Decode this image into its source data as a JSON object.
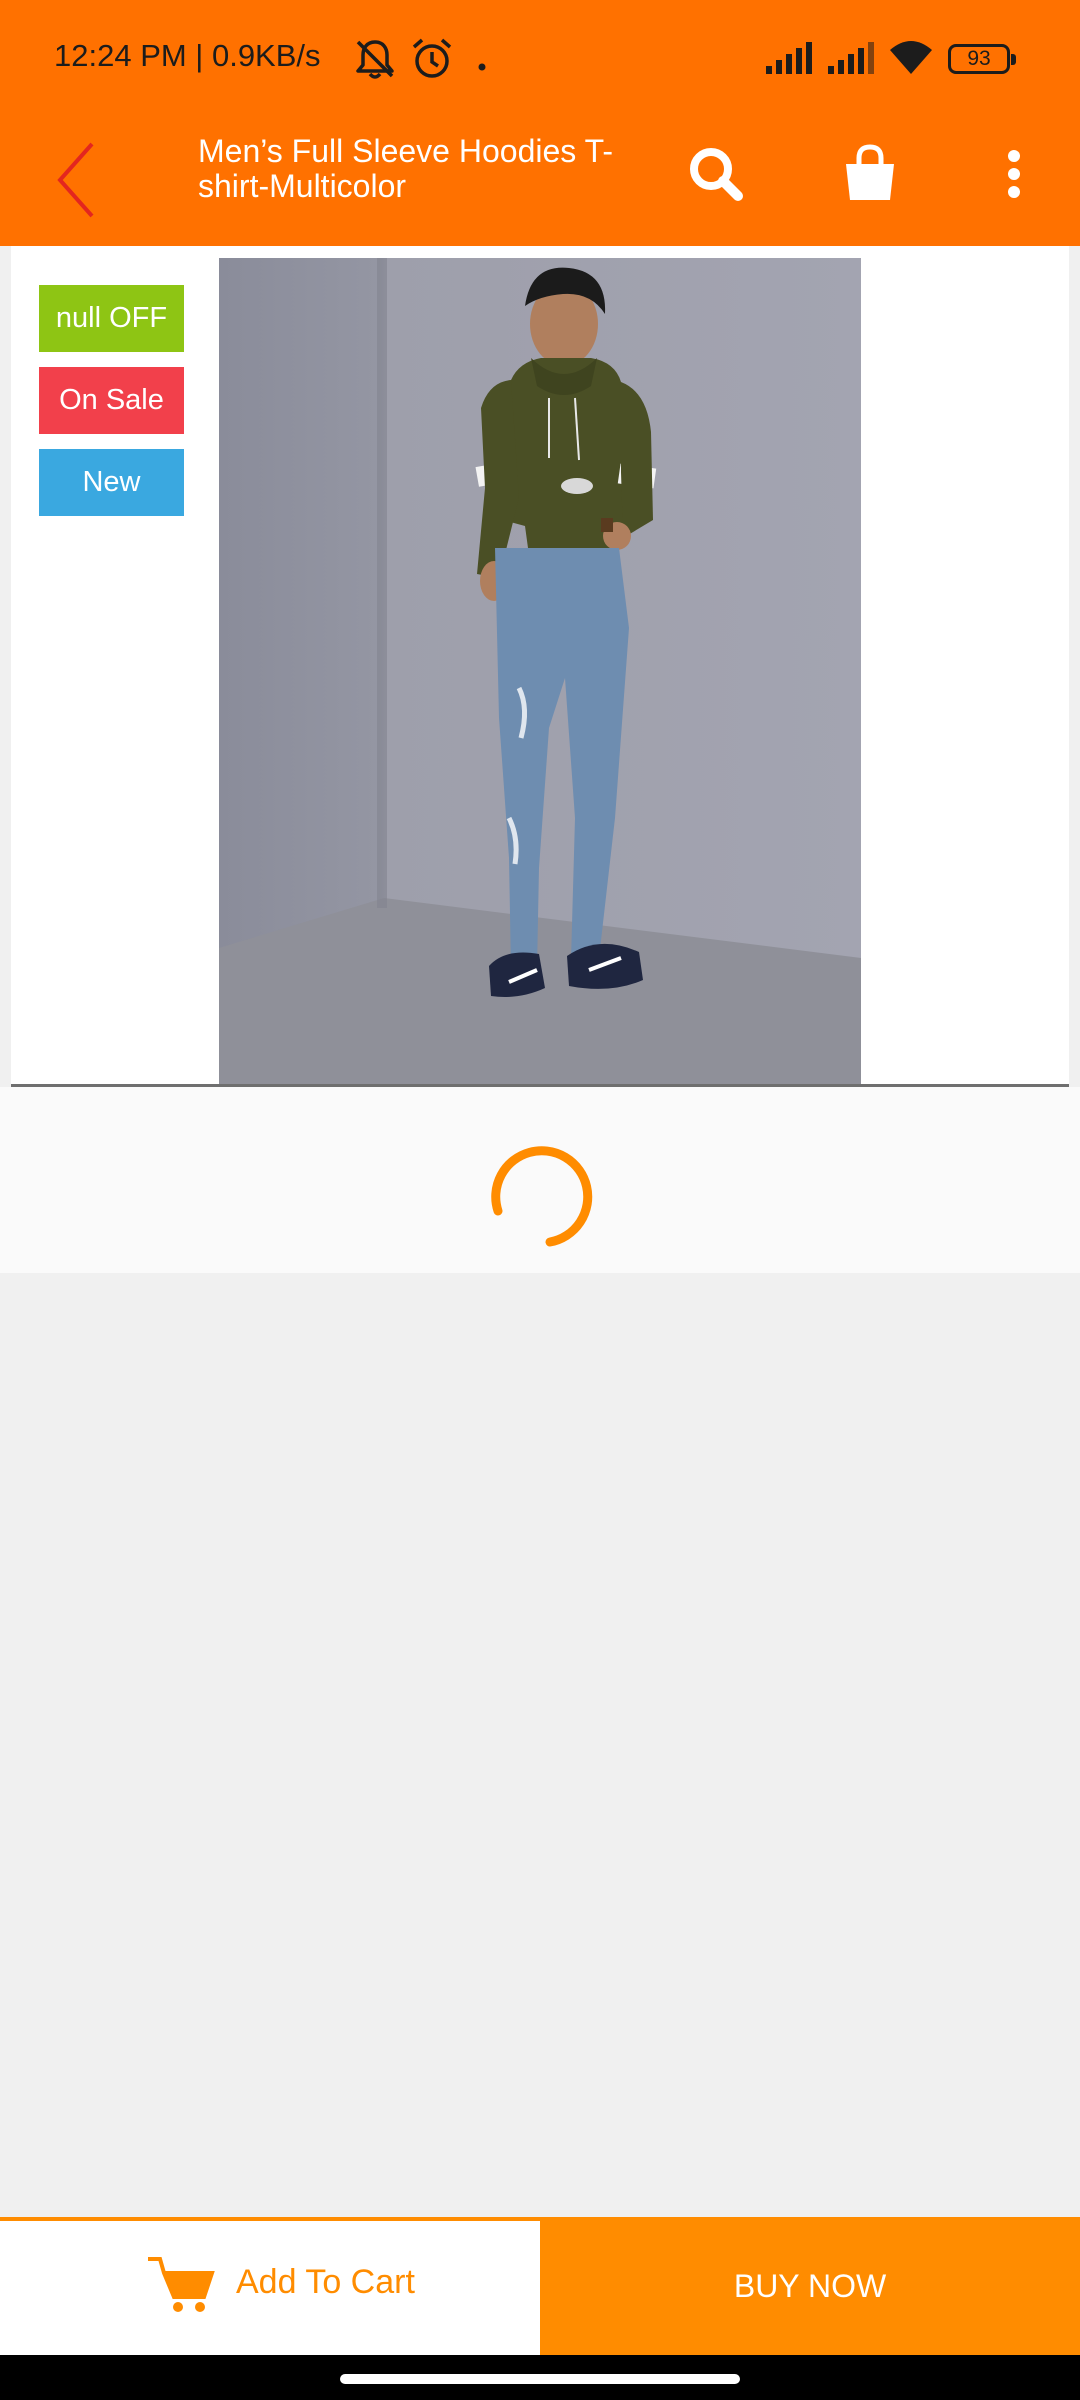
{
  "status_bar": {
    "time_text": "12:24 PM | 0.9KB/s",
    "battery": "93",
    "icons": [
      "mute-icon",
      "alarm-icon",
      "dot-icon",
      "signal-icon",
      "signal-icon",
      "wifi-icon",
      "battery-icon"
    ]
  },
  "app_bar": {
    "title": "Men’s Full Sleeve Hoodies T-shirt-Multicolor",
    "icons": [
      "back-arrow-icon",
      "search-icon",
      "shopping-bag-icon",
      "more-vert-icon"
    ]
  },
  "product": {
    "badges": [
      {
        "label": "null OFF",
        "color": "#8ec514"
      },
      {
        "label": "On Sale",
        "color": "#f2404b"
      },
      {
        "label": "New",
        "color": "#3aa8e0"
      }
    ]
  },
  "actions": {
    "add_to_cart": "Add To Cart",
    "buy_now": "BUY NOW"
  },
  "colors": {
    "brand": "#ff7100",
    "accent": "#ff8c00"
  }
}
